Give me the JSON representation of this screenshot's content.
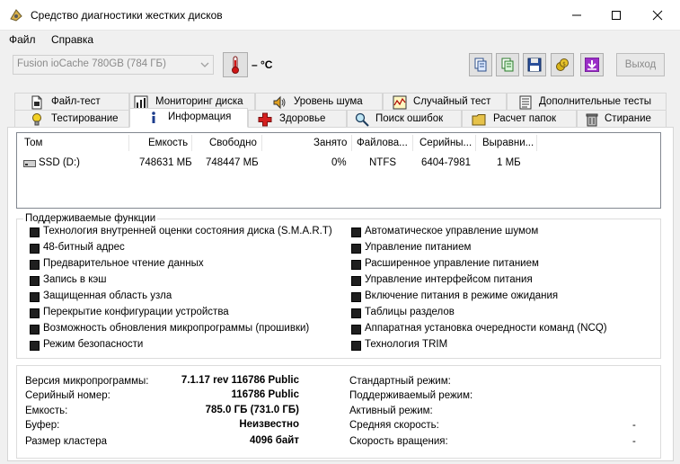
{
  "window": {
    "title": "Средство диагностики жестких дисков"
  },
  "menu": {
    "file": "Файл",
    "help": "Справка"
  },
  "toolbar": {
    "drive": "Fusion ioCache 780GB  (784 ГБ)",
    "temperature": "– °C",
    "exit": "Выход"
  },
  "tabs": {
    "row1": [
      {
        "label": "Файл-тест"
      },
      {
        "label": "Мониторинг диска"
      },
      {
        "label": "Уровень шума"
      },
      {
        "label": "Случайный тест"
      },
      {
        "label": "Дополнительные тесты"
      }
    ],
    "row2": [
      {
        "label": "Тестирование"
      },
      {
        "label": "Информация"
      },
      {
        "label": "Здоровье"
      },
      {
        "label": "Поиск ошибок"
      },
      {
        "label": "Расчет папок"
      },
      {
        "label": "Стирание"
      }
    ]
  },
  "volumes": {
    "headers": [
      "Том",
      "Емкость",
      "Свободно",
      "Занято",
      "Файлова...",
      "Серийны...",
      "Выравни..."
    ],
    "rows": [
      {
        "name": "SSD (D:)",
        "capacity": "748631 МБ",
        "free": "748447 МБ",
        "used": "0%",
        "fs": "NTFS",
        "serial": "6404-7981",
        "align": "1 МБ"
      }
    ]
  },
  "features": {
    "title": "Поддерживаемые функции",
    "left": [
      "Технология внутренней оценки состояния диска (S.M.A.R.T)",
      "48-битный адрес",
      "Предварительное чтение данных",
      "Запись в кэш",
      "Защищенная область узла",
      "Перекрытие конфигурации устройства",
      "Возможность обновления микропрограммы (прошивки)",
      "Режим безопасности"
    ],
    "right": [
      "Автоматическое управление шумом",
      "Управление питанием",
      "Расширенное управление питанием",
      "Управление интерфейсом питания",
      "Включение питания в режиме ожидания",
      "Таблицы разделов",
      "Аппаратная установка очередности команд (NCQ)",
      "Технология TRIM"
    ]
  },
  "info": {
    "left": [
      {
        "label": "Версия микропрограммы:",
        "value": "7.1.17  rev  116786 Public"
      },
      {
        "label": "Серийный номер:",
        "value": "116786 Public"
      },
      {
        "label": "Емкость:",
        "value": "785.0 ГБ (731.0 ГБ)"
      },
      {
        "label": "Буфер:",
        "value": "Неизвестно"
      },
      {
        "label": "Размер кластера",
        "value": "4096 байт"
      }
    ],
    "right": [
      {
        "label": "Стандартный режим:",
        "value": ""
      },
      {
        "label": "Поддерживаемый режим:",
        "value": ""
      },
      {
        "label": "Активный режим:",
        "value": ""
      },
      {
        "label": "Средняя скорость:",
        "value": "-"
      },
      {
        "label": "Скорость вращения:",
        "value": "-"
      }
    ]
  }
}
